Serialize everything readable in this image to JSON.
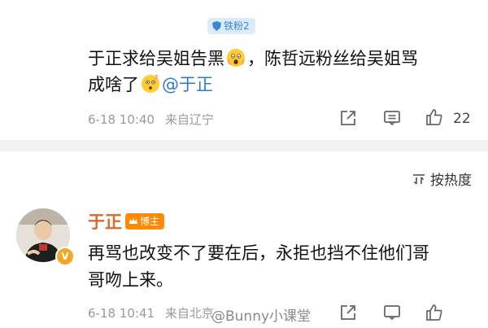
{
  "top_comment": {
    "fan_badge": "铁粉2",
    "line1_a": "于正求给吴姐告黑",
    "line1_b": "，陈哲远粉丝给吴姐骂",
    "line2_a": "成啥了",
    "mention": "@于正",
    "timestamp": "6-18 10:40",
    "location": "来自辽宁",
    "like_count": "22",
    "icons": [
      "share-icon",
      "comment-icon",
      "like-icon"
    ]
  },
  "sort": {
    "label": "按热度"
  },
  "reply": {
    "username": "于正",
    "blogger_badge": "博主",
    "verified_badge": "V",
    "line1": "再骂也改变不了要在后，永拒也挡不住他们哥",
    "line2": "哥吻上来。",
    "timestamp": "6-18 10:41",
    "location": "来自北京"
  },
  "watermark": "@Bunny小课堂",
  "colors": {
    "mention": "#2f79c9",
    "username": "#d9682e",
    "blogger_badge": "#ff8a00",
    "fan_badge_bg": "#dcebfa",
    "separator": "#f2f2f2"
  }
}
